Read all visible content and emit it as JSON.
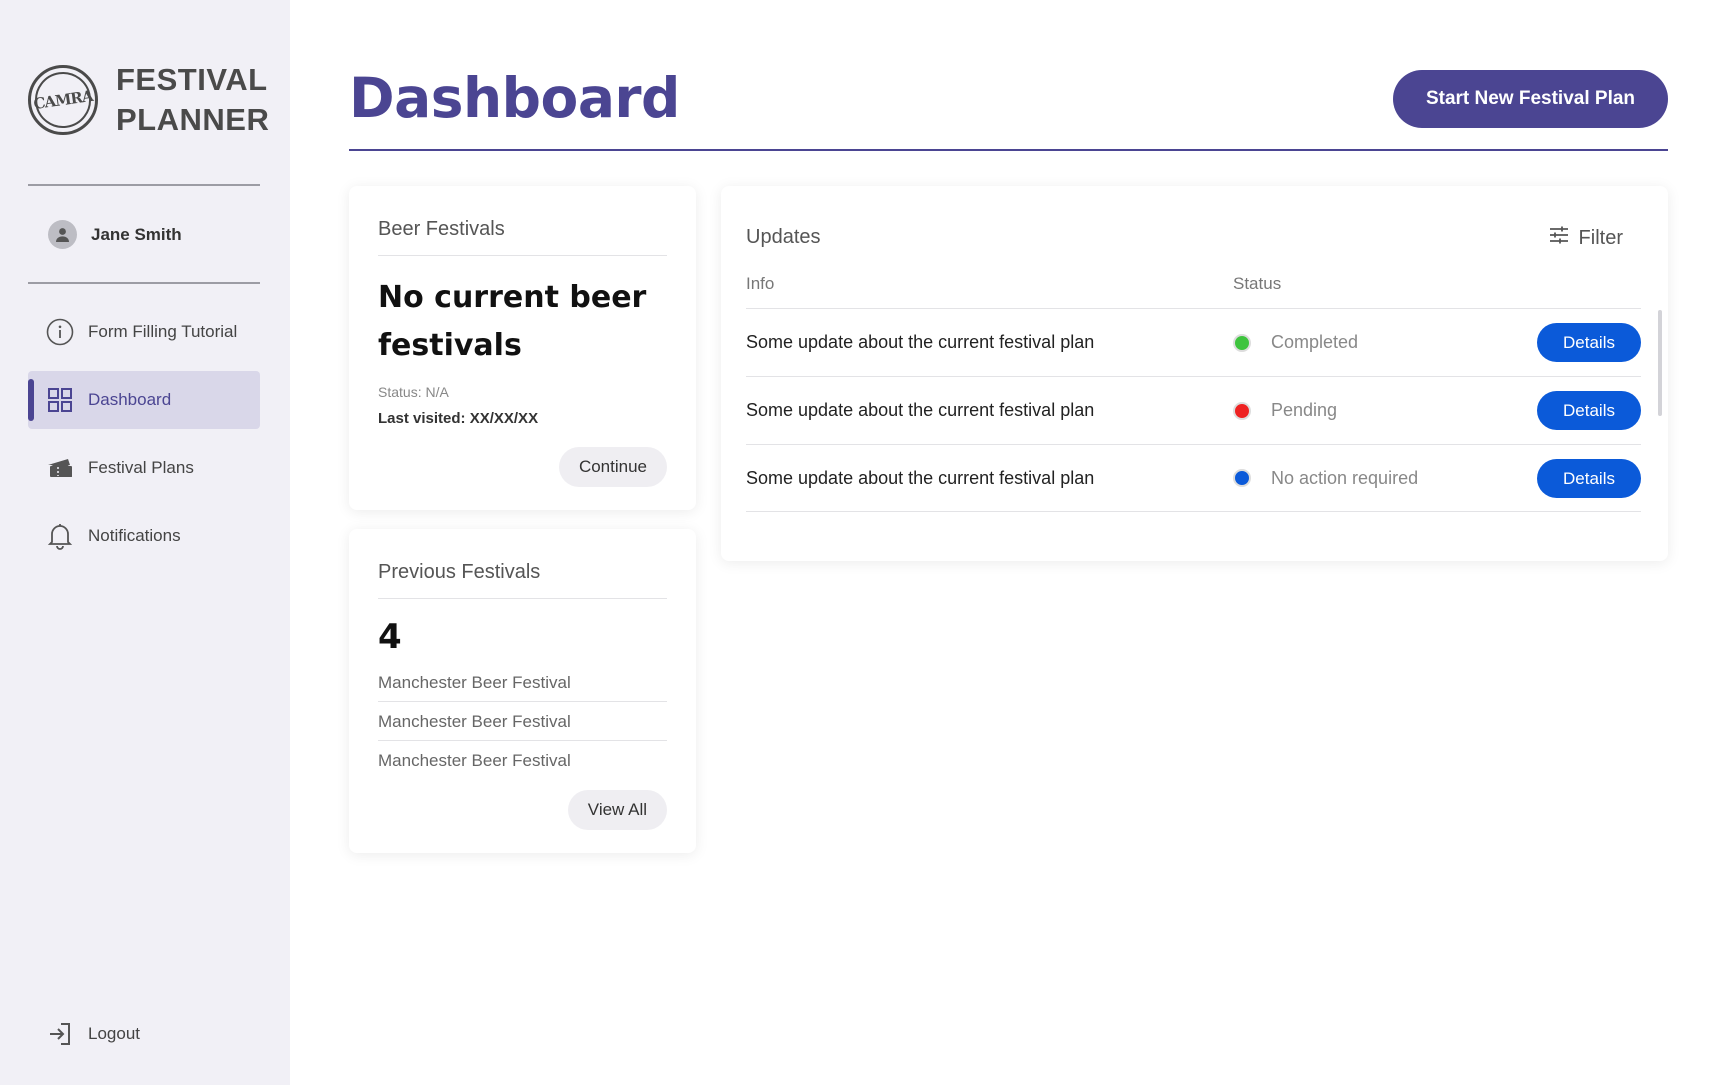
{
  "app": {
    "logo_badge": "CAMRA",
    "name_line1": "FESTIVAL",
    "name_line2": "PLANNER"
  },
  "user": {
    "name": "Jane Smith"
  },
  "sidebar": {
    "items": [
      {
        "label": "Form Filling Tutorial",
        "icon": "info-icon",
        "active": false
      },
      {
        "label": "Dashboard",
        "icon": "grid-icon",
        "active": true
      },
      {
        "label": "Festival Plans",
        "icon": "ticket-icon",
        "active": false
      },
      {
        "label": "Notifications",
        "icon": "bell-icon",
        "active": false
      }
    ],
    "logout_label": "Logout"
  },
  "header": {
    "title": "Dashboard",
    "primary_action": "Start New Festival Plan"
  },
  "beer_festivals": {
    "title": "Beer Festivals",
    "headline": "No current beer festivals",
    "status": "Status: N/A",
    "last_visited_label": "Last visited:",
    "last_visited_value": "XX/XX/XX",
    "action": "Continue"
  },
  "previous_festivals": {
    "title": "Previous Festivals",
    "count": "4",
    "items": [
      "Manchester Beer Festival",
      "Manchester Beer Festival",
      "Manchester Beer Festival"
    ],
    "action": "View All"
  },
  "updates": {
    "title": "Updates",
    "filter_label": "Filter",
    "columns": [
      "Info",
      "Status"
    ],
    "rows": [
      {
        "info": "Some update about the current festival plan",
        "status": "Completed",
        "color": "#3ec43e",
        "action": "Details"
      },
      {
        "info": "Some update about the current festival plan",
        "status": "Pending",
        "color": "#ee2222",
        "action": "Details"
      },
      {
        "info": "Some update about the current festival plan",
        "status": "No action required",
        "color": "#0b5ad9",
        "action": "Details"
      }
    ]
  },
  "colors": {
    "brand": "#4b4592",
    "sidebar_bg": "#f1f0f6",
    "button_blue": "#0b5ad9"
  }
}
